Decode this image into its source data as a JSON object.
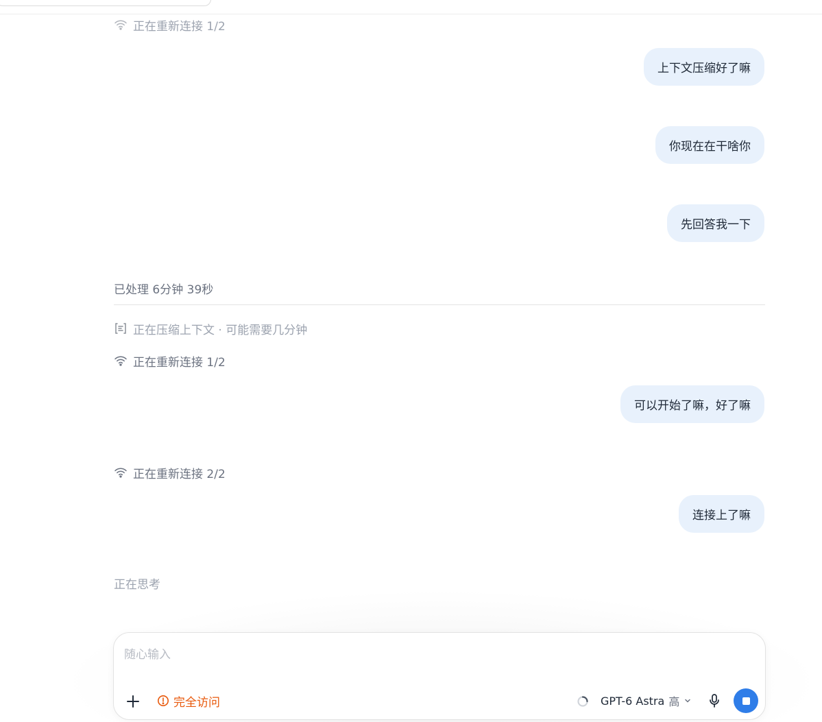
{
  "colors": {
    "bubble_bg": "#e8f1fc",
    "accent_orange": "#e8590c",
    "stop_button": "#2f7de8"
  },
  "messages": [
    {
      "kind": "status",
      "icon": "wifi-icon",
      "text": "正在重新连接 1/2"
    },
    {
      "kind": "user",
      "text": "上下文压缩好了嘛"
    },
    {
      "kind": "user",
      "text": "你现在在干啥你"
    },
    {
      "kind": "user",
      "text": "先回答我一下"
    },
    {
      "kind": "divider",
      "text": "已处理 6分钟 39秒"
    },
    {
      "kind": "status",
      "icon": "compress-icon",
      "text": "正在压缩上下文 · 可能需要几分钟"
    },
    {
      "kind": "status",
      "icon": "wifi-icon",
      "text": "正在重新连接 1/2"
    },
    {
      "kind": "user",
      "text": "可以开始了嘛，好了嘛"
    },
    {
      "kind": "status",
      "icon": "wifi-icon",
      "text": "正在重新连接 2/2"
    },
    {
      "kind": "user",
      "text": "连接上了嘛"
    },
    {
      "kind": "thinking",
      "text": "正在思考"
    }
  ],
  "composer": {
    "placeholder": "随心输入",
    "add_icon": "plus-icon",
    "access_icon": "alert-circle-icon",
    "access_label": "完全访问",
    "model_name": "GPT-6 Astra",
    "model_level": "高",
    "mic_icon": "microphone-icon",
    "stop_icon": "stop-icon"
  }
}
